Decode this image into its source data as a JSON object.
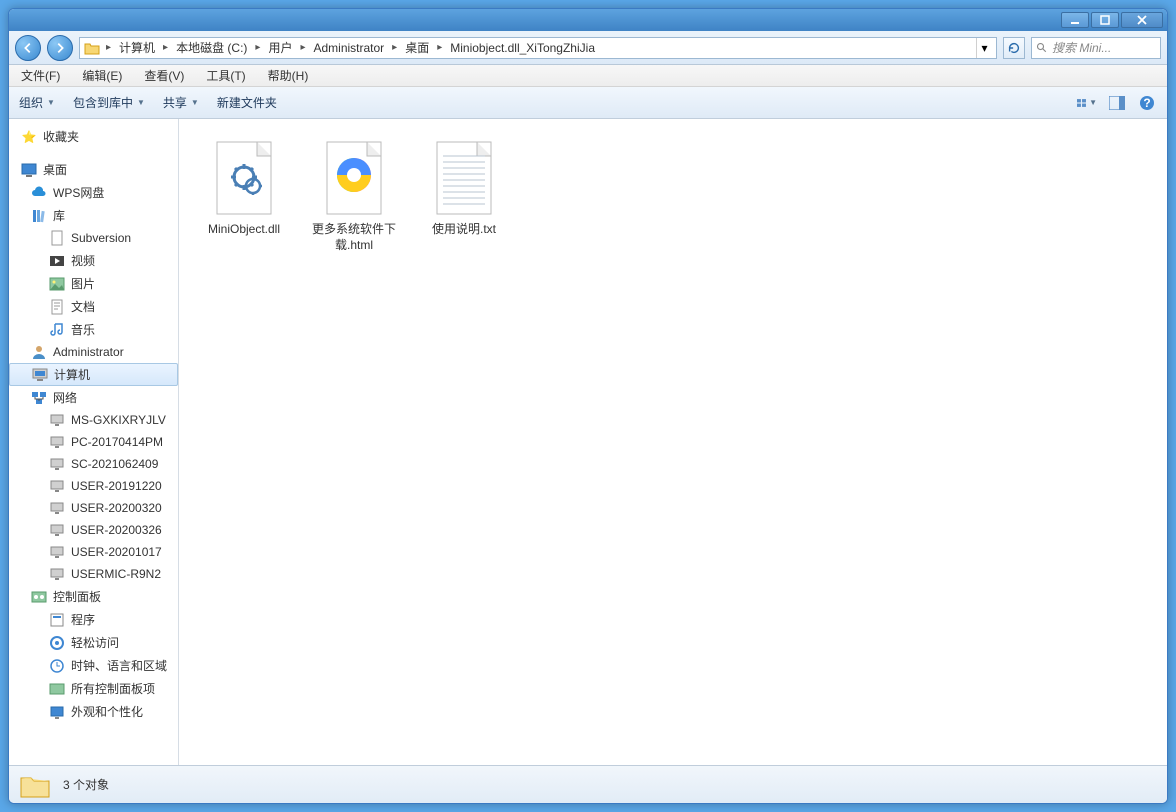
{
  "titlebar": {},
  "breadcrumb": [
    "计算机",
    "本地磁盘 (C:)",
    "用户",
    "Administrator",
    "桌面",
    "Miniobject.dll_XiTongZhiJia"
  ],
  "search_placeholder": "搜索 Mini...",
  "menubar": [
    "文件(F)",
    "编辑(E)",
    "查看(V)",
    "工具(T)",
    "帮助(H)"
  ],
  "toolbar": {
    "organize": "组织",
    "include": "包含到库中",
    "share": "共享",
    "newfolder": "新建文件夹"
  },
  "sidebar": {
    "favorites": "收藏夹",
    "desktop": "桌面",
    "wps": "WPS网盘",
    "libraries": "库",
    "lib_items": [
      "Subversion",
      "视频",
      "图片",
      "文档",
      "音乐"
    ],
    "admin": "Administrator",
    "computer": "计算机",
    "network": "网络",
    "net_items": [
      "MS-GXKIXRYJLV",
      "PC-20170414PM",
      "SC-2021062409",
      "USER-20191220",
      "USER-20200320",
      "USER-20200326",
      "USER-20201017",
      "USERMIC-R9N2"
    ],
    "cpanel": "控制面板",
    "cp_items": [
      "程序",
      "轻松访问",
      "时钟、语言和区域",
      "所有控制面板项",
      "外观和个性化"
    ]
  },
  "files": [
    {
      "name": "MiniObject.dll",
      "type": "dll"
    },
    {
      "name": "更多系统软件下载.html",
      "type": "html"
    },
    {
      "name": "使用说明.txt",
      "type": "txt"
    }
  ],
  "status": "3 个对象"
}
